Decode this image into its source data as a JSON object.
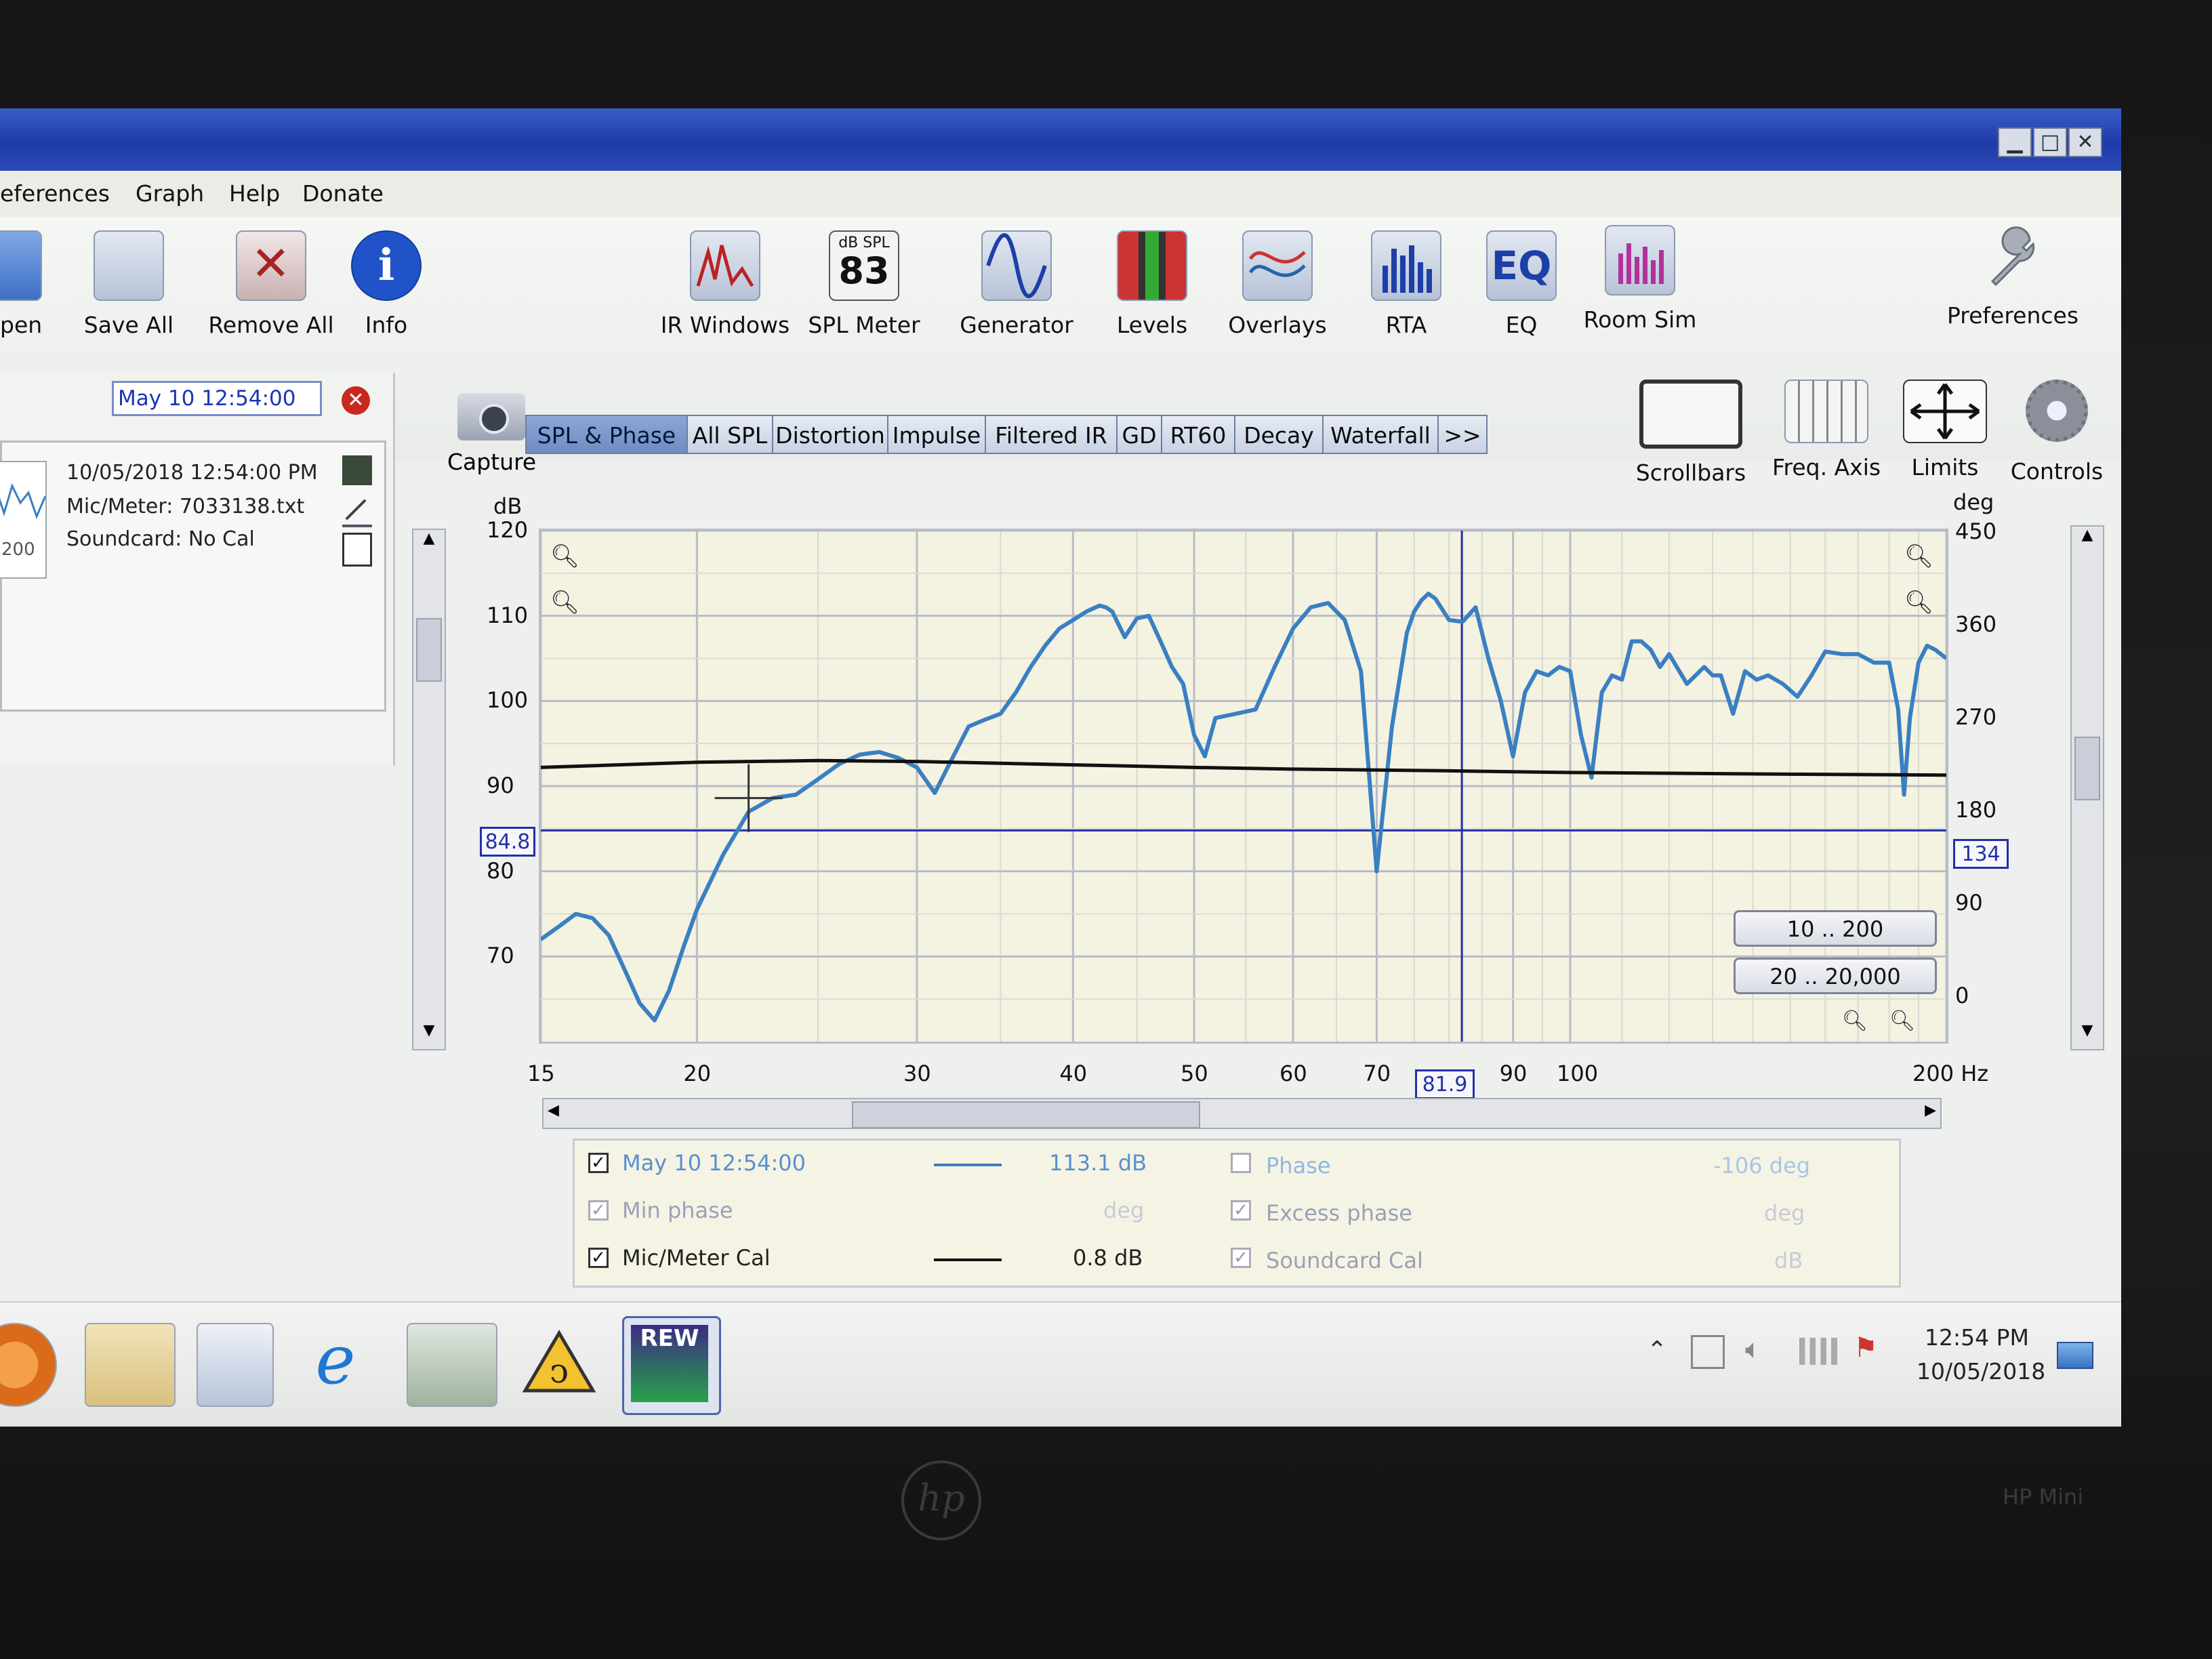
{
  "menu": [
    "eferences",
    "Graph",
    "Help",
    "Donate"
  ],
  "toolbar": {
    "left": [
      {
        "name": "open",
        "label": "pen",
        "icon": "folder-icon"
      },
      {
        "name": "save-all",
        "label": "Save All",
        "icon": "save-icon"
      },
      {
        "name": "remove-all",
        "label": "Remove All",
        "icon": "remove-icon"
      },
      {
        "name": "info",
        "label": "Info",
        "icon": "info-icon"
      }
    ],
    "center": [
      {
        "name": "ir-windows",
        "label": "IR Windows",
        "icon": "ir-windows-icon"
      },
      {
        "name": "spl-meter",
        "label": "SPL Meter",
        "icon": "spl-meter-icon",
        "icon_text_top": "dB SPL",
        "icon_text_value": "83"
      },
      {
        "name": "generator",
        "label": "Generator",
        "icon": "sine-wave-icon"
      },
      {
        "name": "levels",
        "label": "Levels",
        "icon": "levels-icon"
      },
      {
        "name": "overlays",
        "label": "Overlays",
        "icon": "overlays-icon"
      },
      {
        "name": "rta",
        "label": "RTA",
        "icon": "rta-icon"
      },
      {
        "name": "eq",
        "label": "EQ",
        "icon": "eq-icon",
        "icon_text": "EQ"
      },
      {
        "name": "room-sim",
        "label": "Room Sim",
        "icon": "room-sim-icon"
      }
    ],
    "preferences": {
      "label": "Preferences",
      "icon": "wrench-icon"
    }
  },
  "measurement": {
    "name": "May 10 12:54:00",
    "date": "10/05/2018 12:54:00 PM",
    "mic": "Mic/Meter: 7033138.txt",
    "soundcard": "Soundcard: No Cal",
    "thumb_label": "200"
  },
  "capture": {
    "label": "Capture"
  },
  "tabs": [
    "SPL & Phase",
    "All SPL",
    "Distortion",
    "Impulse",
    "Filtered IR",
    "GD",
    "RT60",
    "Decay",
    "Waterfall",
    ">>"
  ],
  "active_tab": "SPL & Phase",
  "graph_controls": [
    {
      "name": "scrollbars",
      "label": "Scrollbars",
      "icon": "scrollbars-icon"
    },
    {
      "name": "freq-axis",
      "label": "Freq. Axis",
      "icon": "freq-axis-icon"
    },
    {
      "name": "limits",
      "label": "Limits",
      "icon": "limits-icon"
    },
    {
      "name": "controls",
      "label": "Controls",
      "icon": "gear-icon"
    }
  ],
  "range_buttons": [
    "10 .. 200",
    "20 .. 20,000"
  ],
  "cursor": {
    "freq": "81.9",
    "db": "84.8",
    "deg": "134"
  },
  "chart_data": {
    "type": "line",
    "ylabel": "dB",
    "ylabel_right": "deg",
    "xunit": "Hz",
    "x_scale": "log",
    "xlim": [
      15,
      200
    ],
    "ylim": [
      60,
      120
    ],
    "ylim_right": [
      -45,
      450
    ],
    "xticks": [
      15,
      20,
      30,
      40,
      50,
      60,
      70,
      90,
      100,
      200
    ],
    "xtick_labels": [
      "15",
      "20",
      "30",
      "40",
      "50",
      "60",
      "70",
      "90",
      "100",
      "200 Hz"
    ],
    "yticks": [
      70,
      80,
      90,
      100,
      110,
      120
    ],
    "yticks_right": [
      0,
      90,
      180,
      270,
      360,
      450
    ],
    "grid": true,
    "series": [
      {
        "name": "May 10 12:54:00",
        "color": "#3a7fc2",
        "x": [
          15,
          15.5,
          16,
          16.5,
          17,
          17.5,
          18,
          18.5,
          19,
          19.5,
          20,
          21,
          22,
          23,
          24,
          25,
          26,
          27,
          28,
          29,
          30,
          31,
          32,
          33,
          34,
          35,
          36,
          37,
          38,
          39,
          40,
          41,
          42,
          42.5,
          43,
          44,
          45,
          46,
          47,
          48,
          49,
          50,
          51,
          52,
          54,
          56,
          58,
          60,
          62,
          64,
          66,
          68,
          70,
          72,
          74,
          75,
          76,
          77,
          78,
          80,
          82,
          84,
          86,
          88,
          90,
          92,
          94,
          96,
          98,
          100,
          102,
          104,
          106,
          108,
          110,
          112,
          114,
          116,
          118,
          120,
          124,
          128,
          130,
          132,
          135,
          138,
          141,
          144,
          148,
          152,
          156,
          160,
          165,
          170,
          175,
          180,
          183,
          185,
          187,
          190,
          193,
          196,
          200
        ],
        "y": [
          72,
          73.5,
          75,
          74.5,
          72.5,
          68.5,
          64.5,
          62.5,
          66,
          71,
          75.5,
          82,
          87,
          88.6,
          89,
          90.8,
          92.6,
          93.7,
          94,
          93.3,
          92.2,
          89.2,
          93.2,
          97,
          97.8,
          98.5,
          101,
          104,
          106.5,
          108.5,
          109.5,
          110.5,
          111.2,
          111,
          110.5,
          107.5,
          109.7,
          110,
          107,
          104,
          102,
          96,
          93.5,
          98,
          98.5,
          99,
          104,
          108.5,
          111,
          111.5,
          109.5,
          103.5,
          80,
          97,
          108,
          110.5,
          111.8,
          112.6,
          112,
          109.5,
          109.3,
          111,
          105,
          100,
          93.5,
          101,
          103.5,
          103,
          104,
          103.5,
          96,
          91,
          101,
          103,
          102.5,
          107,
          107,
          106,
          104,
          105.5,
          102,
          104,
          103,
          103,
          98.5,
          103.5,
          102.5,
          103,
          102,
          100.5,
          103,
          105.8,
          105.5,
          105.5,
          104.5,
          104.5,
          99,
          89,
          98,
          104.5,
          106.5,
          106,
          105
        ],
        "right_label": "113.1 dB"
      },
      {
        "name": "Mic/Meter Cal",
        "color": "#111111",
        "x": [
          15,
          20,
          25,
          30,
          40,
          50,
          60,
          80,
          100,
          150,
          200
        ],
        "y": [
          92.2,
          92.8,
          93,
          92.9,
          92.5,
          92.2,
          92,
          91.8,
          91.6,
          91.4,
          91.3
        ],
        "right_label": "0.8 dB"
      }
    ]
  },
  "legend": [
    {
      "name": "May 10 12:54:00",
      "checked": true,
      "dim": false,
      "value": "113.1 dB",
      "line": "#3a7fc2"
    },
    {
      "name": "Min phase",
      "checked": true,
      "dim": true,
      "value": "deg",
      "line": ""
    },
    {
      "name": "Mic/Meter Cal",
      "checked": true,
      "dim": false,
      "value": "0.8 dB",
      "line": "#111111"
    },
    {
      "name": "Phase",
      "checked": false,
      "dim": true,
      "value": "-106 deg",
      "line": ""
    },
    {
      "name": "Excess phase",
      "checked": true,
      "dim": true,
      "value": "deg",
      "line": ""
    },
    {
      "name": "Soundcard Cal",
      "checked": true,
      "dim": true,
      "value": "dB",
      "line": ""
    }
  ],
  "taskbar": {
    "apps": [
      "media-player-icon",
      "folder-icon",
      "window-icon",
      "internet-explorer-icon",
      "display-icon",
      "warning-icon",
      "rew-icon"
    ],
    "rew_label": "REW",
    "time": "12:54 PM",
    "date": "10/05/2018"
  },
  "bezel": {
    "brand": "hp",
    "model": "HP Mini"
  }
}
